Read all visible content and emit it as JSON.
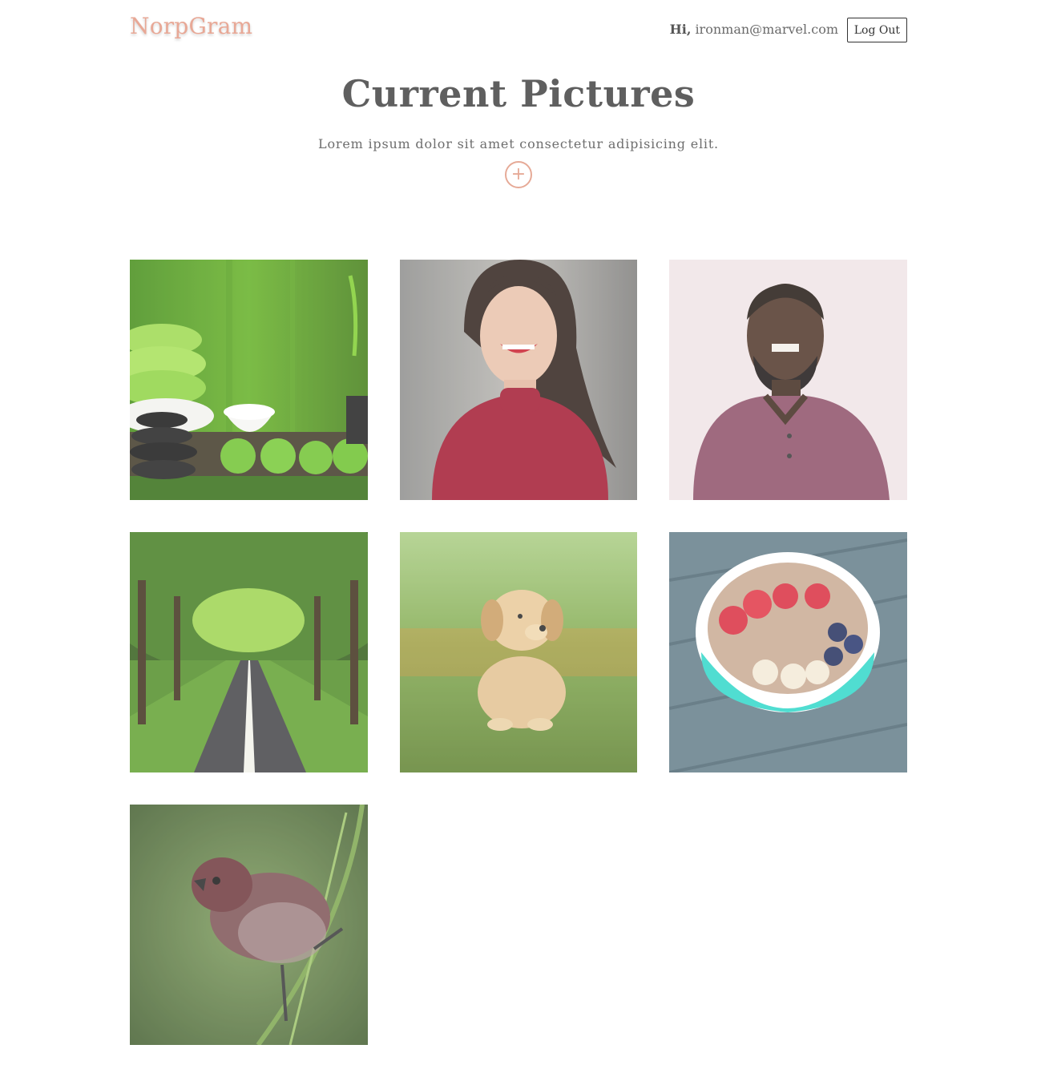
{
  "brand": "NorpGram",
  "user": {
    "greeting": "Hi,",
    "email": "ironman@marvel.com"
  },
  "logout_label": "Log Out",
  "hero": {
    "title": "Current Pictures",
    "subtitle": "Lorem ipsum dolor sit amet consectetur adipisicing elit.",
    "add_icon": "plus-circle-icon",
    "add_glyph": "+"
  },
  "pictures": [
    {
      "subject": "spa-stones-towels"
    },
    {
      "subject": "smiling-woman"
    },
    {
      "subject": "smiling-man"
    },
    {
      "subject": "tree-lined-road"
    },
    {
      "subject": "golden-puppy"
    },
    {
      "subject": "fruit-bowl"
    },
    {
      "subject": "perched-bird"
    }
  ],
  "colors": {
    "brand": "#e8a896",
    "accent": "#e6aa97",
    "text": "#666666"
  }
}
